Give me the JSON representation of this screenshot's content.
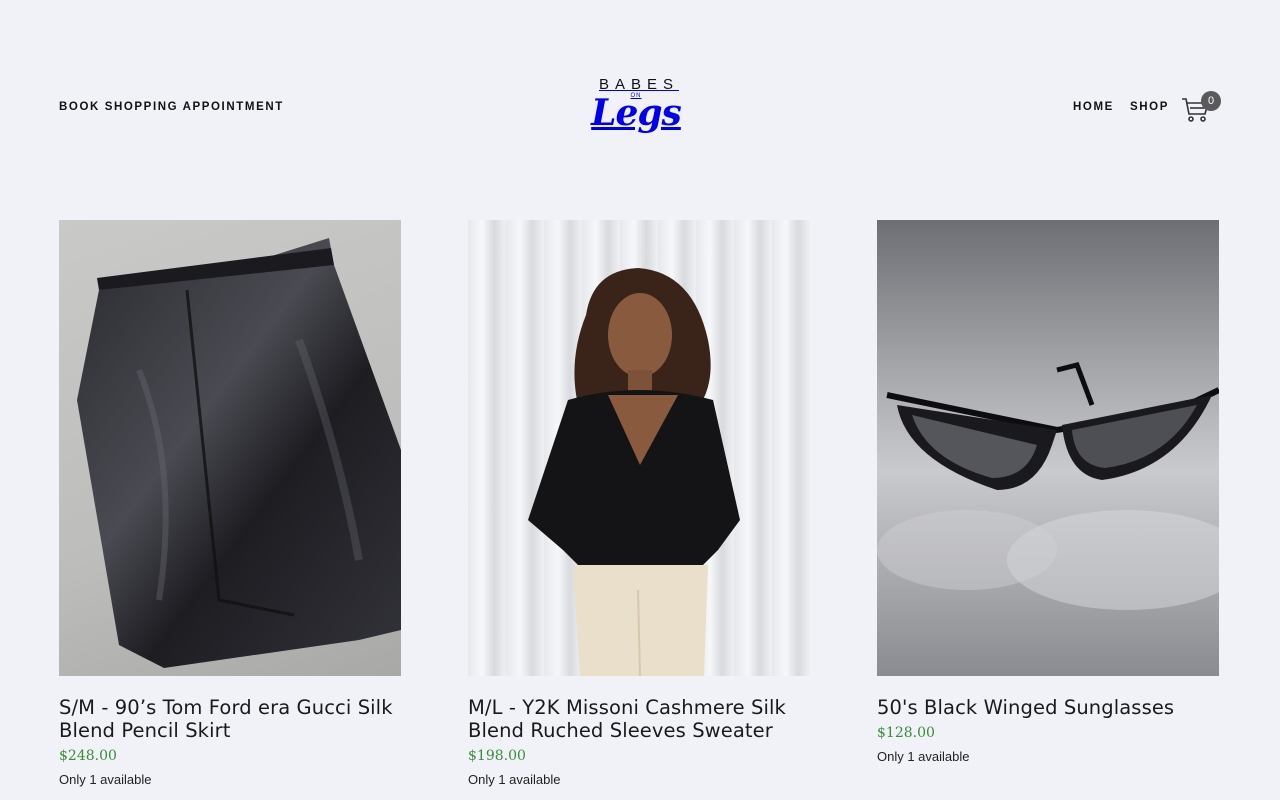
{
  "header": {
    "book_link": "BOOK SHOPPING APPOINTMENT",
    "logo": {
      "top": "BABES",
      "middle": "ON",
      "script": "Legs"
    },
    "nav": [
      {
        "label": "HOME"
      },
      {
        "label": "SHOP"
      }
    ],
    "cart": {
      "icon": "cart-icon",
      "count": "0"
    }
  },
  "products": [
    {
      "title": "S/M - 90’s Tom Ford era Gucci Silk Blend Pencil Skirt",
      "price": "$248.00",
      "availability": "Only 1 available"
    },
    {
      "title": "M/L - Y2K Missoni Cashmere Silk Blend Ruched Sleeves Sweater",
      "price": "$198.00",
      "availability": "Only 1 available"
    },
    {
      "title": "50's Black Winged Sunglasses",
      "price": "$128.00",
      "availability": "Only 1 available"
    }
  ],
  "colors": {
    "background": "#f1f2f7",
    "price": "#3d8a3b",
    "badge": "#5a5a5a"
  }
}
